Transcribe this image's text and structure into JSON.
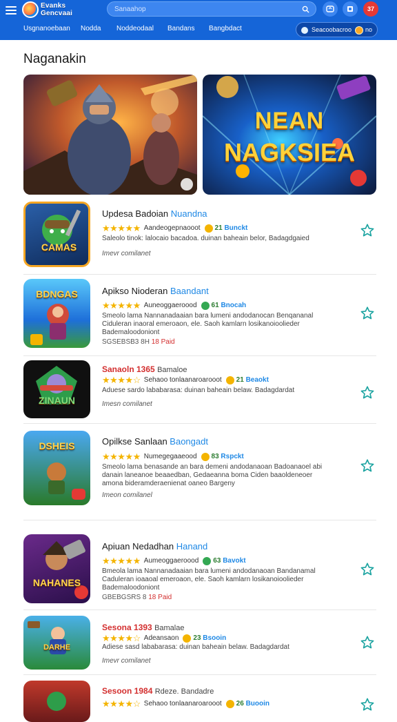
{
  "header": {
    "logo_text": "Evanks Gencvaai",
    "search_placeholder": "Sanaahop",
    "notifications_count": "37",
    "nav": [
      "Usgnanoebaan",
      "Nodda",
      "Noddeodaal",
      "Bandans",
      "Bangbdact"
    ],
    "account": {
      "label": "Seacoobacroo",
      "value": "no"
    }
  },
  "page": {
    "heading": "Naganakin"
  },
  "banners": [
    {
      "line1": "",
      "line2": ""
    },
    {
      "line1": "NEAN",
      "line2": "NAGKSIEA"
    }
  ],
  "apps": [
    {
      "icon_label": "CAMAS",
      "title": "Updesa Badoian",
      "tag": "Nuandna",
      "rating": 4.5,
      "developer": "Aandeogepnaooot",
      "badge_color": "#f4b400",
      "count": "21",
      "count_tag": "Bunckt",
      "description": "Saleolo tinok: lalocaio bacadoa. duinan baheain belor, Badagdgaied",
      "meta": "Imevr comilanet",
      "meta_red": ""
    },
    {
      "icon_label": "BDNGAS",
      "title": "Apikso Nioderan",
      "tag": "Baandant",
      "rating": 4.5,
      "developer": "Auneoggaeroood",
      "badge_color": "#34a853",
      "count": "61",
      "count_tag": "Bnocah",
      "description": "Smeolo lama Nannanadaaian bara lumeni andodanocan Benqananal Ciduleran inaoral emeroaon, ele. Saoh kamlarn losikanoioolieder Bademaloodoniont",
      "meta": "SGSEBSB3 8H",
      "meta_red": "18 Paid"
    },
    {
      "icon_label": "ZINAUN",
      "title": "Sanaoln 1365",
      "title_red": true,
      "sub": "Bamaloe",
      "rating": 3.5,
      "developer": "Sehaoo tonlaanaroarooot",
      "badge_color": "#f4b400",
      "count": "21",
      "count_tag": "Beaokt",
      "description": "Aduese sardo lababarasa: duinan baheain belaw. Badagdardat",
      "meta": "Imesn comilanet",
      "meta_red": ""
    },
    {
      "icon_label": "DSHEIS",
      "title": "Opilkse Sanlaan",
      "tag": "Baongadt",
      "rating": 5,
      "developer": "Numegegaaeood",
      "badge_color": "#f4b400",
      "count": "83",
      "count_tag": "Rspckt",
      "description": "Smeolo lama benasande an bara demeni andodanaoan Badoanaoel abi danain laneanoe beaaedban, Gedaeanna boma Ciden baaoldeneoer amona bideramderaenienat oaneo Bargeny",
      "meta": "Imeon comilanel",
      "meta_red": ""
    },
    {
      "icon_label": "NAHANES",
      "title": "Apiuan Nedadhan",
      "tag": "Hanand",
      "rating": 5,
      "developer": "Aumeoggaeroood",
      "badge_color": "#34a853",
      "count": "63",
      "count_tag": "Bavokt",
      "description": "Bmeola lama Nannanadaaian bara lumeni andodanaoan Bandanamal Caduleran ioaaoal emeroaon, ele. Saoh kamlarn losikanoioolieder Bademaloodoniont",
      "meta": "GBEBGSRS 8",
      "meta_red": "18 Paid"
    },
    {
      "icon_label": "DARHE",
      "title": "Sesona 1393",
      "title_red": true,
      "sub": "Bamalae",
      "rating": 3.5,
      "developer": "Adeansaon",
      "badge_color": "#f4b400",
      "count": "23",
      "count_tag": "Bsooin",
      "description": "Adiese sasd lababarasa: duinan baheain belaw. Badagdardat",
      "meta": "Imevr comilanet",
      "meta_red": ""
    },
    {
      "icon_label": "",
      "title": "Sesoon 1984",
      "title_red": true,
      "sub": "Rdeze. Bandadre",
      "rating": 4,
      "developer": "Sehaoo tonlaanaroarooot",
      "badge_color": "#f4b400",
      "count": "26",
      "count_tag": "Buooin",
      "description": "",
      "meta": "",
      "meta_red": ""
    }
  ],
  "colors": {
    "header": "#1565d8",
    "accent": "#1e88e5",
    "star": "#f4b400",
    "fav": "#1aa3a0"
  }
}
